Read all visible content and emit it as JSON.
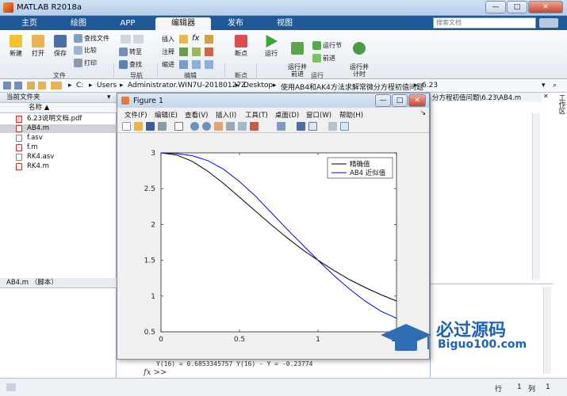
{
  "app": {
    "title": "MATLAB R2018a",
    "window_controls": [
      "—",
      "□",
      "✕"
    ]
  },
  "ribbon_tabs": [
    {
      "label": "主页",
      "active": false
    },
    {
      "label": "绘图",
      "active": false
    },
    {
      "label": "APP",
      "active": false
    },
    {
      "label": "编辑器",
      "active": true
    },
    {
      "label": "发布",
      "active": false
    },
    {
      "label": "视图",
      "active": false
    }
  ],
  "search": {
    "placeholder": "搜索文档"
  },
  "ribbon": {
    "file_group": {
      "label": "文件",
      "new": "新建",
      "open": "打开",
      "save": "保存",
      "find_files": "查找文件",
      "compare": "比较",
      "print": "打印"
    },
    "nav_group": {
      "label": "导航",
      "goto": "转至",
      "find": "查找"
    },
    "edit_group": {
      "label": "编辑",
      "insert": "插入",
      "comment": "注释",
      "indent": "缩进"
    },
    "breakpoint_group": {
      "label": "断点",
      "breakpoints": "断点"
    },
    "run_group": {
      "label": "运行",
      "run": "运行",
      "run_advance": "运行并\n前进",
      "run_section": "运行节",
      "advance": "前进",
      "run_time": "运行并\n计时"
    }
  },
  "address": {
    "segments": [
      "C:",
      "Users",
      "Administrator.WIN7U-20180127Z",
      "Desktop",
      "使用AB4和AK4方法求解常微分方程初值问题",
      "6.23"
    ]
  },
  "left_panel": {
    "header": "当前文件夹",
    "column": "名称",
    "files": [
      {
        "name": "6.23说明文档.pdf",
        "type": "pdf",
        "selected": false
      },
      {
        "name": "AB4.m",
        "type": "m",
        "selected": true
      },
      {
        "name": "f.asv",
        "type": "asv",
        "selected": false
      },
      {
        "name": "f.m",
        "type": "m",
        "selected": false
      },
      {
        "name": "RK4.asv",
        "type": "asv",
        "selected": false
      },
      {
        "name": "RK4.m",
        "type": "m",
        "selected": false
      }
    ],
    "details": "AB4.m （脚本）"
  },
  "editor": {
    "path_fragment": "分方程初值问题\\6.23\\AB4.m",
    "workspace_label": "工作区"
  },
  "command_window": {
    "output_line": "Y(16) = 0.6853345757    Y(16) - Y = -0.23774",
    "prompt": "fx >>"
  },
  "status": {
    "row_label": "行",
    "row": "1",
    "col_label": "列",
    "col": "1"
  },
  "figure": {
    "title": "Figure 1",
    "menu": [
      "文件(F)",
      "编辑(E)",
      "查看(V)",
      "插入(I)",
      "工具(T)",
      "桌面(D)",
      "窗口(W)",
      "帮助(H)"
    ]
  },
  "chart_data": {
    "type": "line",
    "title": "",
    "xlabel": "",
    "ylabel": "",
    "xlim": [
      0,
      1.5
    ],
    "ylim": [
      0.5,
      3
    ],
    "xticks": [
      0,
      0.5,
      1,
      1.5
    ],
    "yticks": [
      0.5,
      1,
      1.5,
      2,
      2.5,
      3
    ],
    "xtick_labels": [
      "0",
      "0.5",
      "1",
      "1.5"
    ],
    "ytick_labels": [
      "0.5",
      "1",
      "1.5",
      "2",
      "2.5",
      "3"
    ],
    "legend_position": "top-right",
    "grid": false,
    "series": [
      {
        "name": "精确值",
        "color": "#000000",
        "x": [
          0,
          0.1,
          0.2,
          0.3,
          0.4,
          0.5,
          0.6,
          0.7,
          0.8,
          0.9,
          1.0,
          1.1,
          1.2,
          1.3,
          1.4,
          1.5
        ],
        "y": [
          3.0,
          2.97,
          2.88,
          2.74,
          2.57,
          2.38,
          2.19,
          2.0,
          1.82,
          1.65,
          1.5,
          1.36,
          1.23,
          1.12,
          1.02,
          0.93
        ]
      },
      {
        "name": "AB4 近似值",
        "color": "#0000ff",
        "x": [
          0,
          0.1,
          0.2,
          0.3,
          0.4,
          0.5,
          0.6,
          0.7,
          0.8,
          0.9,
          1.0,
          1.1,
          1.2,
          1.3,
          1.4,
          1.5
        ],
        "y": [
          3.0,
          2.99,
          2.96,
          2.89,
          2.77,
          2.6,
          2.4,
          2.17,
          1.94,
          1.72,
          1.5,
          1.29,
          1.1,
          0.93,
          0.79,
          0.69
        ]
      }
    ]
  },
  "watermark": {
    "brand": "必过源码",
    "domain": "Biguo100.com"
  },
  "colors": {
    "tabbar": "#1f5a96",
    "accent": "#0000ff"
  }
}
